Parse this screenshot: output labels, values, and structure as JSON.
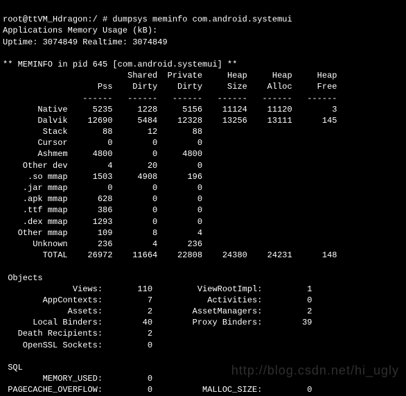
{
  "prompt": "root@ttVM_Hdragon:/ # dumpsys meminfo com.android.systemui\nApplications Memory Usage (kB):\nUptime: 3074849 Realtime: 3074849\n",
  "meminfo": {
    "header": "** MEMINFO in pid 645 [com.android.systemui] **",
    "columns": [
      "Pss",
      "Shared Dirty",
      "Private Dirty",
      "Heap Size",
      "Heap Alloc",
      "Heap Free"
    ],
    "rows": [
      {
        "label": "Native",
        "pss": "5235",
        "shared_dirty": "1228",
        "private_dirty": "5156",
        "heap_size": "11124",
        "heap_alloc": "11120",
        "heap_free": "3"
      },
      {
        "label": "Dalvik",
        "pss": "12690",
        "shared_dirty": "5484",
        "private_dirty": "12328",
        "heap_size": "13256",
        "heap_alloc": "13111",
        "heap_free": "145"
      },
      {
        "label": "Stack",
        "pss": "88",
        "shared_dirty": "12",
        "private_dirty": "88"
      },
      {
        "label": "Cursor",
        "pss": "0",
        "shared_dirty": "0",
        "private_dirty": "0"
      },
      {
        "label": "Ashmem",
        "pss": "4800",
        "shared_dirty": "0",
        "private_dirty": "4800"
      },
      {
        "label": "Other dev",
        "pss": "4",
        "shared_dirty": "20",
        "private_dirty": "0"
      },
      {
        "label": ".so mmap",
        "pss": "1503",
        "shared_dirty": "4908",
        "private_dirty": "196"
      },
      {
        "label": ".jar mmap",
        "pss": "0",
        "shared_dirty": "0",
        "private_dirty": "0"
      },
      {
        "label": ".apk mmap",
        "pss": "628",
        "shared_dirty": "0",
        "private_dirty": "0"
      },
      {
        "label": ".ttf mmap",
        "pss": "386",
        "shared_dirty": "0",
        "private_dirty": "0"
      },
      {
        "label": ".dex mmap",
        "pss": "1293",
        "shared_dirty": "0",
        "private_dirty": "0"
      },
      {
        "label": "Other mmap",
        "pss": "109",
        "shared_dirty": "8",
        "private_dirty": "4"
      },
      {
        "label": "Unknown",
        "pss": "236",
        "shared_dirty": "4",
        "private_dirty": "236"
      },
      {
        "label": "TOTAL",
        "pss": "26972",
        "shared_dirty": "11664",
        "private_dirty": "22808",
        "heap_size": "24380",
        "heap_alloc": "24231",
        "heap_free": "148"
      }
    ]
  },
  "objects": {
    "title": " Objects",
    "pairs": [
      {
        "l": "Views",
        "lv": "110",
        "r": "ViewRootImpl",
        "rv": "1"
      },
      {
        "l": "AppContexts",
        "lv": "7",
        "r": "Activities",
        "rv": "0"
      },
      {
        "l": "Assets",
        "lv": "2",
        "r": "AssetManagers",
        "rv": "2"
      },
      {
        "l": "Local Binders",
        "lv": "40",
        "r": "Proxy Binders",
        "rv": "39"
      },
      {
        "l": "Death Recipients",
        "lv": "2"
      },
      {
        "l": "OpenSSL Sockets",
        "lv": "0"
      }
    ]
  },
  "sql": {
    "title": " SQL",
    "pairs": [
      {
        "l": "MEMORY_USED",
        "lv": "0"
      },
      {
        "l": "PAGECACHE_OVERFLOW",
        "lv": "0",
        "r": "MALLOC_SIZE",
        "rv": "0"
      }
    ]
  },
  "watermark": "http://blog.csdn.net/hi_ugly"
}
